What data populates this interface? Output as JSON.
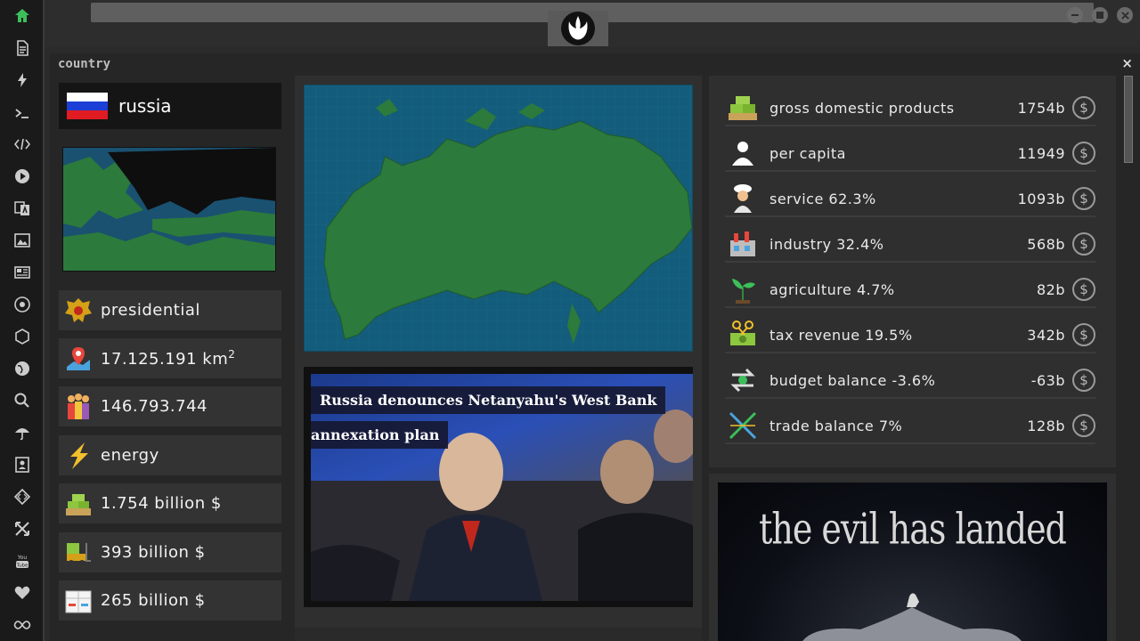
{
  "window": {
    "title": "country",
    "close_label": "×"
  },
  "country": {
    "name": "russia",
    "flag_colors": [
      "#ffffff",
      "#1c3fd6",
      "#e11b22"
    ]
  },
  "stats": [
    {
      "icon": "coat-of-arms-icon",
      "text": "presidential"
    },
    {
      "icon": "map-pin-icon",
      "text": "17.125.191 km",
      "sup": "2"
    },
    {
      "icon": "population-icon",
      "text": "146.793.744"
    },
    {
      "icon": "lightning-icon",
      "text": "energy"
    },
    {
      "icon": "money-stack-icon",
      "text": "1.754 billion $"
    },
    {
      "icon": "forklift-icon",
      "text": "393 billion $"
    },
    {
      "icon": "boxes-icon",
      "text": "265 billion $"
    }
  ],
  "news": {
    "headline_line1": "Russia denounces Netanyahu's West Bank",
    "headline_line2": "annexation plan"
  },
  "economy": [
    {
      "icon": "money-stack-icon",
      "label": "gross domestic products",
      "value": "1754b"
    },
    {
      "icon": "person-icon",
      "label": "per capita",
      "value": "11949"
    },
    {
      "icon": "chef-icon",
      "label": "service 62.3%",
      "value": "1093b"
    },
    {
      "icon": "factory-icon",
      "label": "industry 32.4%",
      "value": "568b"
    },
    {
      "icon": "plant-icon",
      "label": "agriculture 4.7%",
      "value": "82b"
    },
    {
      "icon": "tax-scissors-icon",
      "label": "tax revenue 19.5%",
      "value": "342b"
    },
    {
      "icon": "balance-arrows-icon",
      "label": "budget balance -3.6%",
      "value": "-63b"
    },
    {
      "icon": "trade-arrows-icon",
      "label": "trade balance 7%",
      "value": "128b"
    }
  ],
  "coin_symbol": "$",
  "promo": {
    "text": "the evil has landed"
  },
  "colors": {
    "accent_green": "#3cbf5a",
    "map_sea": "#135c7b",
    "map_land": "#2c7a3c"
  }
}
